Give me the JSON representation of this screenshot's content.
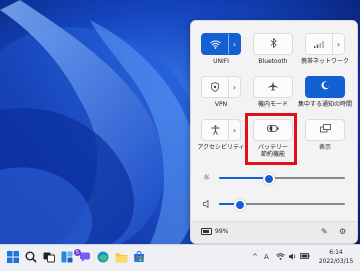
{
  "quick_settings": {
    "tiles": [
      {
        "label": "UNIFI",
        "icon": "wifi-icon",
        "active": true
      },
      {
        "label": "Bluetooth",
        "icon": "bluetooth-icon",
        "active": false
      },
      {
        "label": "携帯ネットワーク",
        "icon": "cellular-icon",
        "active": false
      },
      {
        "label": "VPN",
        "icon": "shield-icon",
        "active": false
      },
      {
        "label": "機内モード",
        "icon": "airplane-icon",
        "active": false
      },
      {
        "label": "集中する通知の時間",
        "icon": "moon-icon",
        "active": true
      },
      {
        "label": "アクセシビリティ",
        "icon": "accessibility-icon",
        "active": false
      },
      {
        "label": "バッテリー\n節約機能",
        "icon": "battery-saver-icon",
        "active": false
      },
      {
        "label": "表示",
        "icon": "cast-icon",
        "active": false
      }
    ],
    "brightness_level": 0.4,
    "volume_level": 0.17,
    "battery_text": "99%"
  },
  "taskbar": {
    "chat_badge": "5",
    "language": "A",
    "time": "6:14",
    "date": "2022/03/15"
  },
  "colors": {
    "accent": "#1360d2",
    "highlight": "#e0101a"
  }
}
